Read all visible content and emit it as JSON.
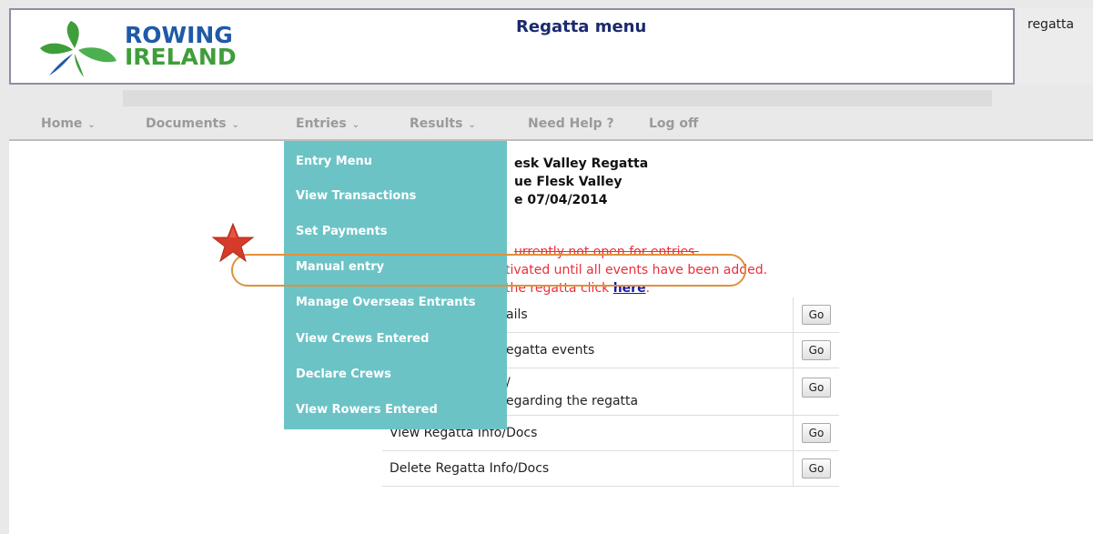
{
  "header": {
    "brand_line1": "ROWING",
    "brand_line2": "IRELAND",
    "page_title": "Regatta menu",
    "user_label": "regatta"
  },
  "nav": {
    "items": [
      {
        "label": "Home",
        "has_caret": true
      },
      {
        "label": "Documents",
        "has_caret": true
      },
      {
        "label": "Entries",
        "has_caret": true
      },
      {
        "label": "Results",
        "has_caret": true
      },
      {
        "label": "Need Help ?",
        "has_caret": false
      },
      {
        "label": "Log off",
        "has_caret": false
      }
    ],
    "caret": "⌄"
  },
  "regatta_info": {
    "line1": "esk Valley Regatta",
    "line2": "ue Flesk Valley",
    "line3": "e 07/04/2014"
  },
  "notices": {
    "line1": "urrently not open for entries.",
    "line2": "tivated until all events have been added.",
    "line3_prefix": " the regatta click ",
    "line3_link": "here",
    "line3_suffix": "."
  },
  "actions": [
    {
      "label": "ails",
      "button": "Go"
    },
    {
      "label": "egatta events",
      "button": "Go"
    },
    {
      "label_line1": "/",
      "label_line2": "egarding the regatta",
      "button": "Go"
    },
    {
      "label": "View Regatta Info/Docs",
      "button": "Go"
    },
    {
      "label": "Delete Regatta Info/Docs",
      "button": "Go"
    }
  ],
  "entries_dropdown": {
    "items": [
      "Entry Menu",
      "View Transactions",
      "Set Payments",
      "Manual entry",
      "Manage Overseas Entrants",
      "View Crews Entered",
      "Declare Crews",
      "View Rowers Entered"
    ],
    "highlighted_item": "Manual entry"
  },
  "colors": {
    "dropdown_bg": "#6cc3c6",
    "notice_red": "#e8303a",
    "highlight_orange": "#e0913a",
    "star_red": "#d63a2a"
  }
}
